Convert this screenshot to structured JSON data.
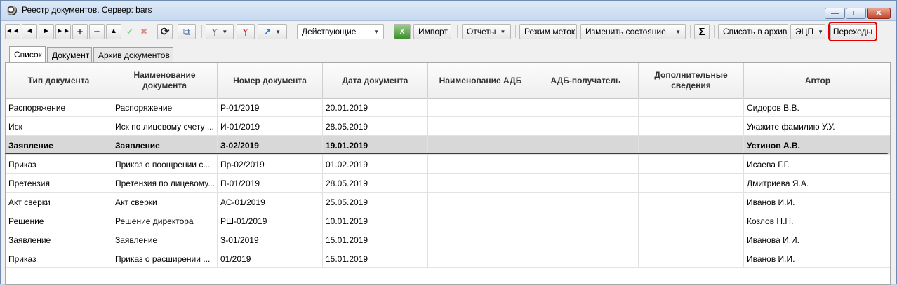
{
  "window": {
    "title": "Реестр документов. Сервер: bars"
  },
  "toolbar": {
    "nav_first": "◄◄",
    "nav_prev": "◄",
    "nav_next": "►",
    "nav_last": "►►",
    "add": "+",
    "remove": "−",
    "up": "▲",
    "confirm": "✔",
    "cancel": "✖",
    "refresh": "⟳",
    "copy": "⧉",
    "filter": "Ⲩ",
    "filter_clear": "Ⲩ",
    "arrow": "↗",
    "status_combo": "Действующие",
    "import_label": "Импорт",
    "reports_label": "Отчеты",
    "marks_mode_label": "Режим меток",
    "change_state_label": "Изменить состояние",
    "sigma": "Σ",
    "archive_label": "Списать в архив",
    "ecp_label": "ЭЦП",
    "transitions_label": "Переходы"
  },
  "tabs": [
    "Список",
    "Документ",
    "Архив документов"
  ],
  "columns": [
    "Тип документа",
    "Наименование документа",
    "Номер документа",
    "Дата документа",
    "Наименование АДБ",
    "АДБ-получатель",
    "Дополнительные сведения",
    "Автор"
  ],
  "rows": [
    [
      "Распоряжение",
      "Распоряжение",
      "Р-01/2019",
      "20.01.2019",
      "",
      "",
      "",
      "Сидоров В.В."
    ],
    [
      "Иск",
      "Иск по лицевому счету ...",
      "И-01/2019",
      "28.05.2019",
      "",
      "",
      "",
      "Укажите фамилию У.У."
    ],
    [
      "Заявление",
      "Заявление",
      "З-02/2019",
      "19.01.2019",
      "",
      "",
      "",
      "Устинов А.В."
    ],
    [
      "Приказ",
      "Приказ о поощрении с...",
      "Пр-02/2019",
      "01.02.2019",
      "",
      "",
      "",
      "Исаева Г.Г."
    ],
    [
      "Претензия",
      "Претензия по лицевому...",
      "П-01/2019",
      "28.05.2019",
      "",
      "",
      "",
      "Дмитриева Я.А."
    ],
    [
      "Акт сверки",
      "Акт сверки",
      "АС-01/2019",
      "25.05.2019",
      "",
      "",
      "",
      "Иванов И.И."
    ],
    [
      "Решение",
      "Решение директора",
      "РШ-01/2019",
      "10.01.2019",
      "",
      "",
      "",
      "Козлов Н.Н."
    ],
    [
      "Заявление",
      "Заявление",
      "З-01/2019",
      "15.01.2019",
      "",
      "",
      "",
      "Иванова И.И."
    ],
    [
      "Приказ",
      "Приказ о расширении ...",
      "01/2019",
      "15.01.2019",
      "",
      "",
      "",
      "Иванов И.И."
    ]
  ]
}
